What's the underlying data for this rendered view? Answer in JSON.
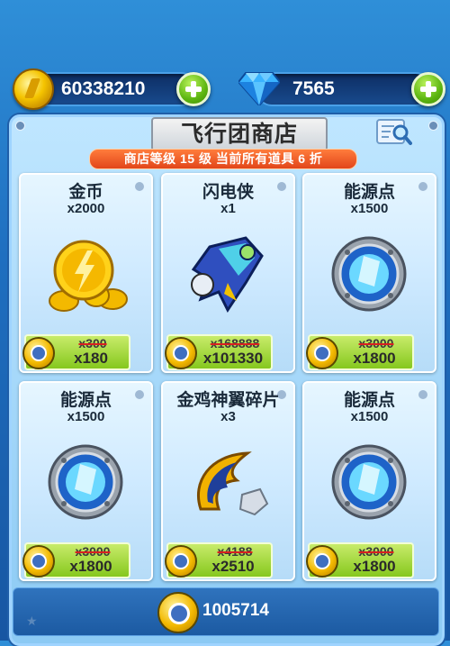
{
  "currency": {
    "gold": {
      "value": "60338210",
      "icon": "gold-coin-icon"
    },
    "gems": {
      "value": "7565",
      "icon": "diamond-icon"
    }
  },
  "shop": {
    "title": "飞行团商店",
    "info": "商店等级 15 级 当前所有道具 6 折",
    "items": [
      {
        "name": "金币",
        "qty": "x2000",
        "old_price": "x300",
        "price": "x180",
        "art": "gold-coins-icon"
      },
      {
        "name": "闪电侠",
        "qty": "x1",
        "old_price": "x168888",
        "price": "x101330",
        "art": "lightning-fighter-icon"
      },
      {
        "name": "能源点",
        "qty": "x1500",
        "old_price": "x3000",
        "price": "x1800",
        "art": "energy-orb-icon"
      },
      {
        "name": "能源点",
        "qty": "x1500",
        "old_price": "x3000",
        "price": "x1800",
        "art": "energy-orb-icon"
      },
      {
        "name": "金鸡神翼碎片",
        "qty": "x3",
        "old_price": "x4188",
        "price": "x2510",
        "art": "golden-wing-fragment-icon"
      },
      {
        "name": "能源点",
        "qty": "x1500",
        "old_price": "x3000",
        "price": "x1800",
        "art": "energy-orb-icon"
      }
    ],
    "balance": "1005714"
  }
}
